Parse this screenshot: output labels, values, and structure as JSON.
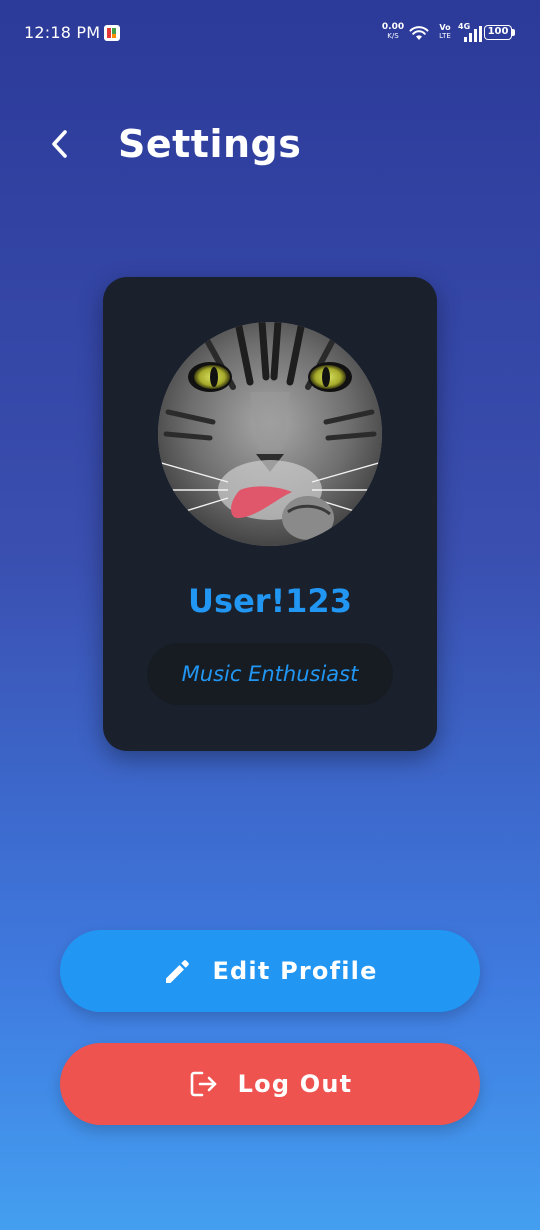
{
  "status_bar": {
    "time": "12:18 PM",
    "net_speed_value": "0.00",
    "net_speed_unit": "K/S",
    "volte_top": "Vo",
    "volte_bottom": "LTE",
    "network_type": "4G",
    "battery": "100",
    "icons": [
      "app-indicator-icon",
      "wifi-icon",
      "signal-icon",
      "battery-icon"
    ]
  },
  "header": {
    "back_icon": "chevron-left-icon",
    "title": "Settings"
  },
  "profile": {
    "username": "User!123",
    "bio": "Music Enthusiast",
    "avatar": "cat-photo"
  },
  "actions": {
    "edit_label": "Edit Profile",
    "edit_icon": "pencil-icon",
    "logout_label": "Log Out",
    "logout_icon": "logout-icon"
  },
  "colors": {
    "accent": "#2196f3",
    "danger": "#ef5350",
    "card": "#1a212d"
  }
}
